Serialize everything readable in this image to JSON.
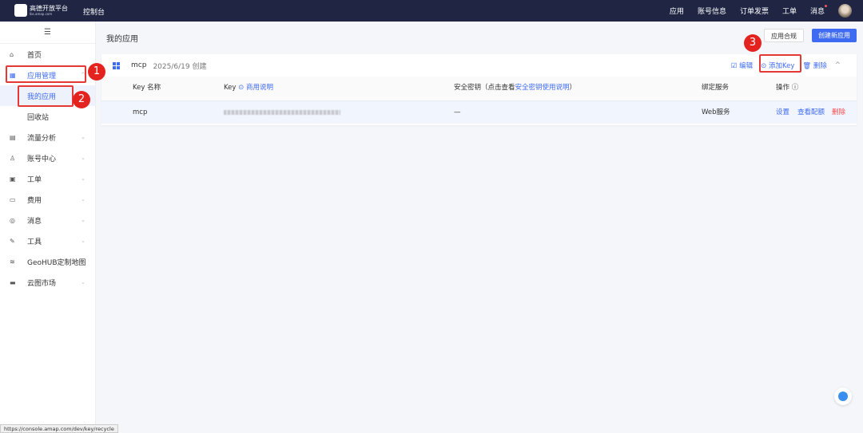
{
  "header": {
    "logo_text": "高德开放平台",
    "logo_sub": "lbs.amap.com",
    "console": "控制台",
    "nav": [
      "应用",
      "账号信息",
      "订单发票",
      "工单",
      "消息"
    ]
  },
  "sidebar": {
    "menu_icon": "☰",
    "items": [
      {
        "icon": "⌂",
        "label": "首页"
      },
      {
        "icon": "▦",
        "label": "应用管理",
        "chev": "^"
      },
      {
        "label": "我的应用"
      },
      {
        "label": "回收站"
      },
      {
        "icon": "▤",
        "label": "流量分析",
        "chev": "⌄"
      },
      {
        "icon": "♙",
        "label": "账号中心",
        "chev": "⌄"
      },
      {
        "icon": "▣",
        "label": "工单",
        "chev": "⌄"
      },
      {
        "icon": "▭",
        "label": "费用",
        "chev": "⌄"
      },
      {
        "icon": "◎",
        "label": "消息",
        "chev": "⌄"
      },
      {
        "icon": "✎",
        "label": "工具",
        "chev": "⌄"
      },
      {
        "icon": "≋",
        "label": "GeoHUB定制地图"
      },
      {
        "icon": "▬",
        "label": "云图市场",
        "chev": "⌄"
      }
    ]
  },
  "main": {
    "title": "我的应用",
    "btn_compliance": "应用合规",
    "btn_create": "创建新应用",
    "app": {
      "name": "mcp",
      "created": "2025/6/19 创建",
      "edit": "☑ 编辑",
      "add_key": "⊙ 添加Key",
      "delete": "🗑 删除",
      "collapse": "^"
    },
    "columns": {
      "key_name": "Key 名称",
      "key": "Key",
      "key_link": "⊙ 商用说明",
      "secret": "安全密钥（点击查看",
      "secret_link": "安全密钥使用说明",
      "secret_end": "）",
      "service": "绑定服务",
      "ops": "操作 ⓘ"
    },
    "row": {
      "key_name": "mcp",
      "secret": "—",
      "service": "Web服务",
      "set": "设置",
      "quota": "查看配额",
      "delete": "删除"
    }
  },
  "annotations": [
    "1",
    "2",
    "3"
  ],
  "status_url": "https://console.amap.com/dev/key/recycle"
}
